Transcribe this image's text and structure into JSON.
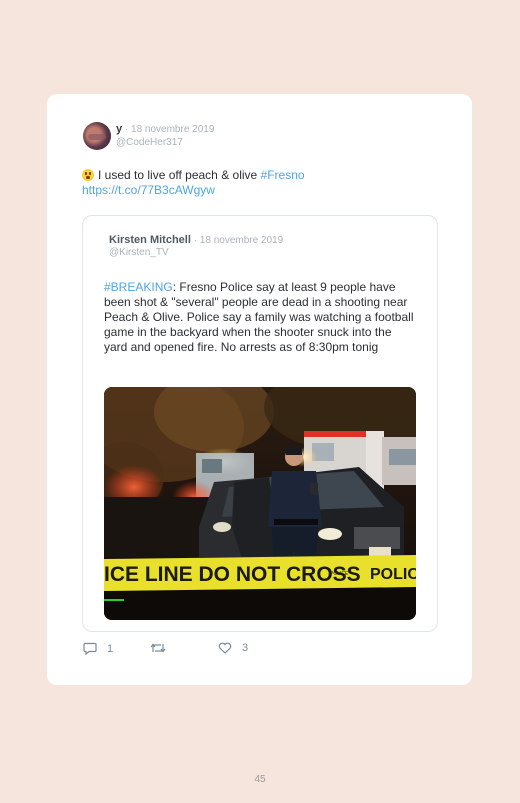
{
  "tweet": {
    "author_name": "y",
    "date": " · 18 novembre 2019",
    "handle": "@CodeHer317",
    "text": "I used to live off peach & olive ",
    "hashtag": "#Fresno",
    "url": "https://t.co/77B3cAWgyw",
    "reply_count": "1",
    "like_count": "3"
  },
  "quoted": {
    "author_name": "Kirsten Mitchell",
    "date": " · 18 novembre 2019",
    "handle": "@Kirsten_TV",
    "hashtag": "#BREAKING",
    "text": ": Fresno Police say at least 9 people have been shot & \"several\" people are dead in a shooting near Peach & Olive. Police say a family was watching a football game in the backyard when the shooter snuck into the yard and opened fire. No arrests as of 8:30pm tonig",
    "photo": {
      "tape_text": "ICE LINE DO NOT CROSS",
      "tape_text_2": "POLIC",
      "tape_small": "POLICE"
    }
  },
  "icons": [
    "reply-icon",
    "retweet-icon",
    "like-icon"
  ],
  "colors": {
    "link": "#4da5e8",
    "background": "#f6e5dc",
    "tape": "#e8e02a"
  },
  "page_number": "45"
}
